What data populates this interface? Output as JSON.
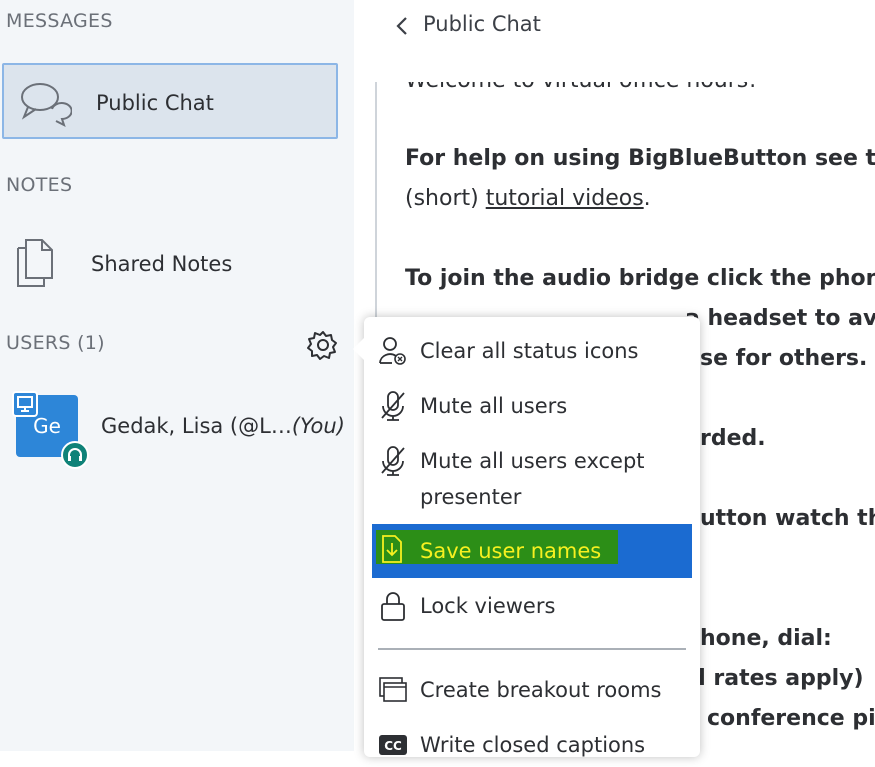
{
  "sidebar": {
    "messages_title": "MESSAGES",
    "public_chat_label": "Public Chat",
    "notes_title": "NOTES",
    "shared_notes_label": "Shared Notes",
    "users_title": "USERS (1)"
  },
  "user": {
    "initials": "Ge",
    "name": "Gedak, Lisa (@L…",
    "you_suffix": "(You)"
  },
  "chat": {
    "title": "Public Chat",
    "lines": {
      "l0": "Welcome to virtual office hours!",
      "l1a": "For help on using BigBlueButton see the",
      "l1b_pre": "(short) ",
      "l1b_link": "tutorial videos",
      "l1b_post": ".",
      "l2": "To join the audio bridge click the phone",
      "l3": "a headset to av",
      "l4": "se for others.",
      "l5": "rded.",
      "l6": "utton watch the",
      "l7": "hone, dial:",
      "l8": "d rates apply)",
      "l9": "conference pi"
    }
  },
  "menu": {
    "clear_status": "Clear all status icons",
    "mute_all": "Mute all users",
    "mute_except_1": "Mute all users except",
    "mute_except_2": "presenter",
    "save_names": "Save user names",
    "lock_viewers": "Lock viewers",
    "breakout": "Create breakout rooms",
    "captions": "Write closed captions"
  },
  "colors": {
    "highlight_bg": "#1b6bd1",
    "highlight_text": "#f7f020",
    "avatar": "#2d86d8",
    "audio_badge": "#0f8278"
  }
}
